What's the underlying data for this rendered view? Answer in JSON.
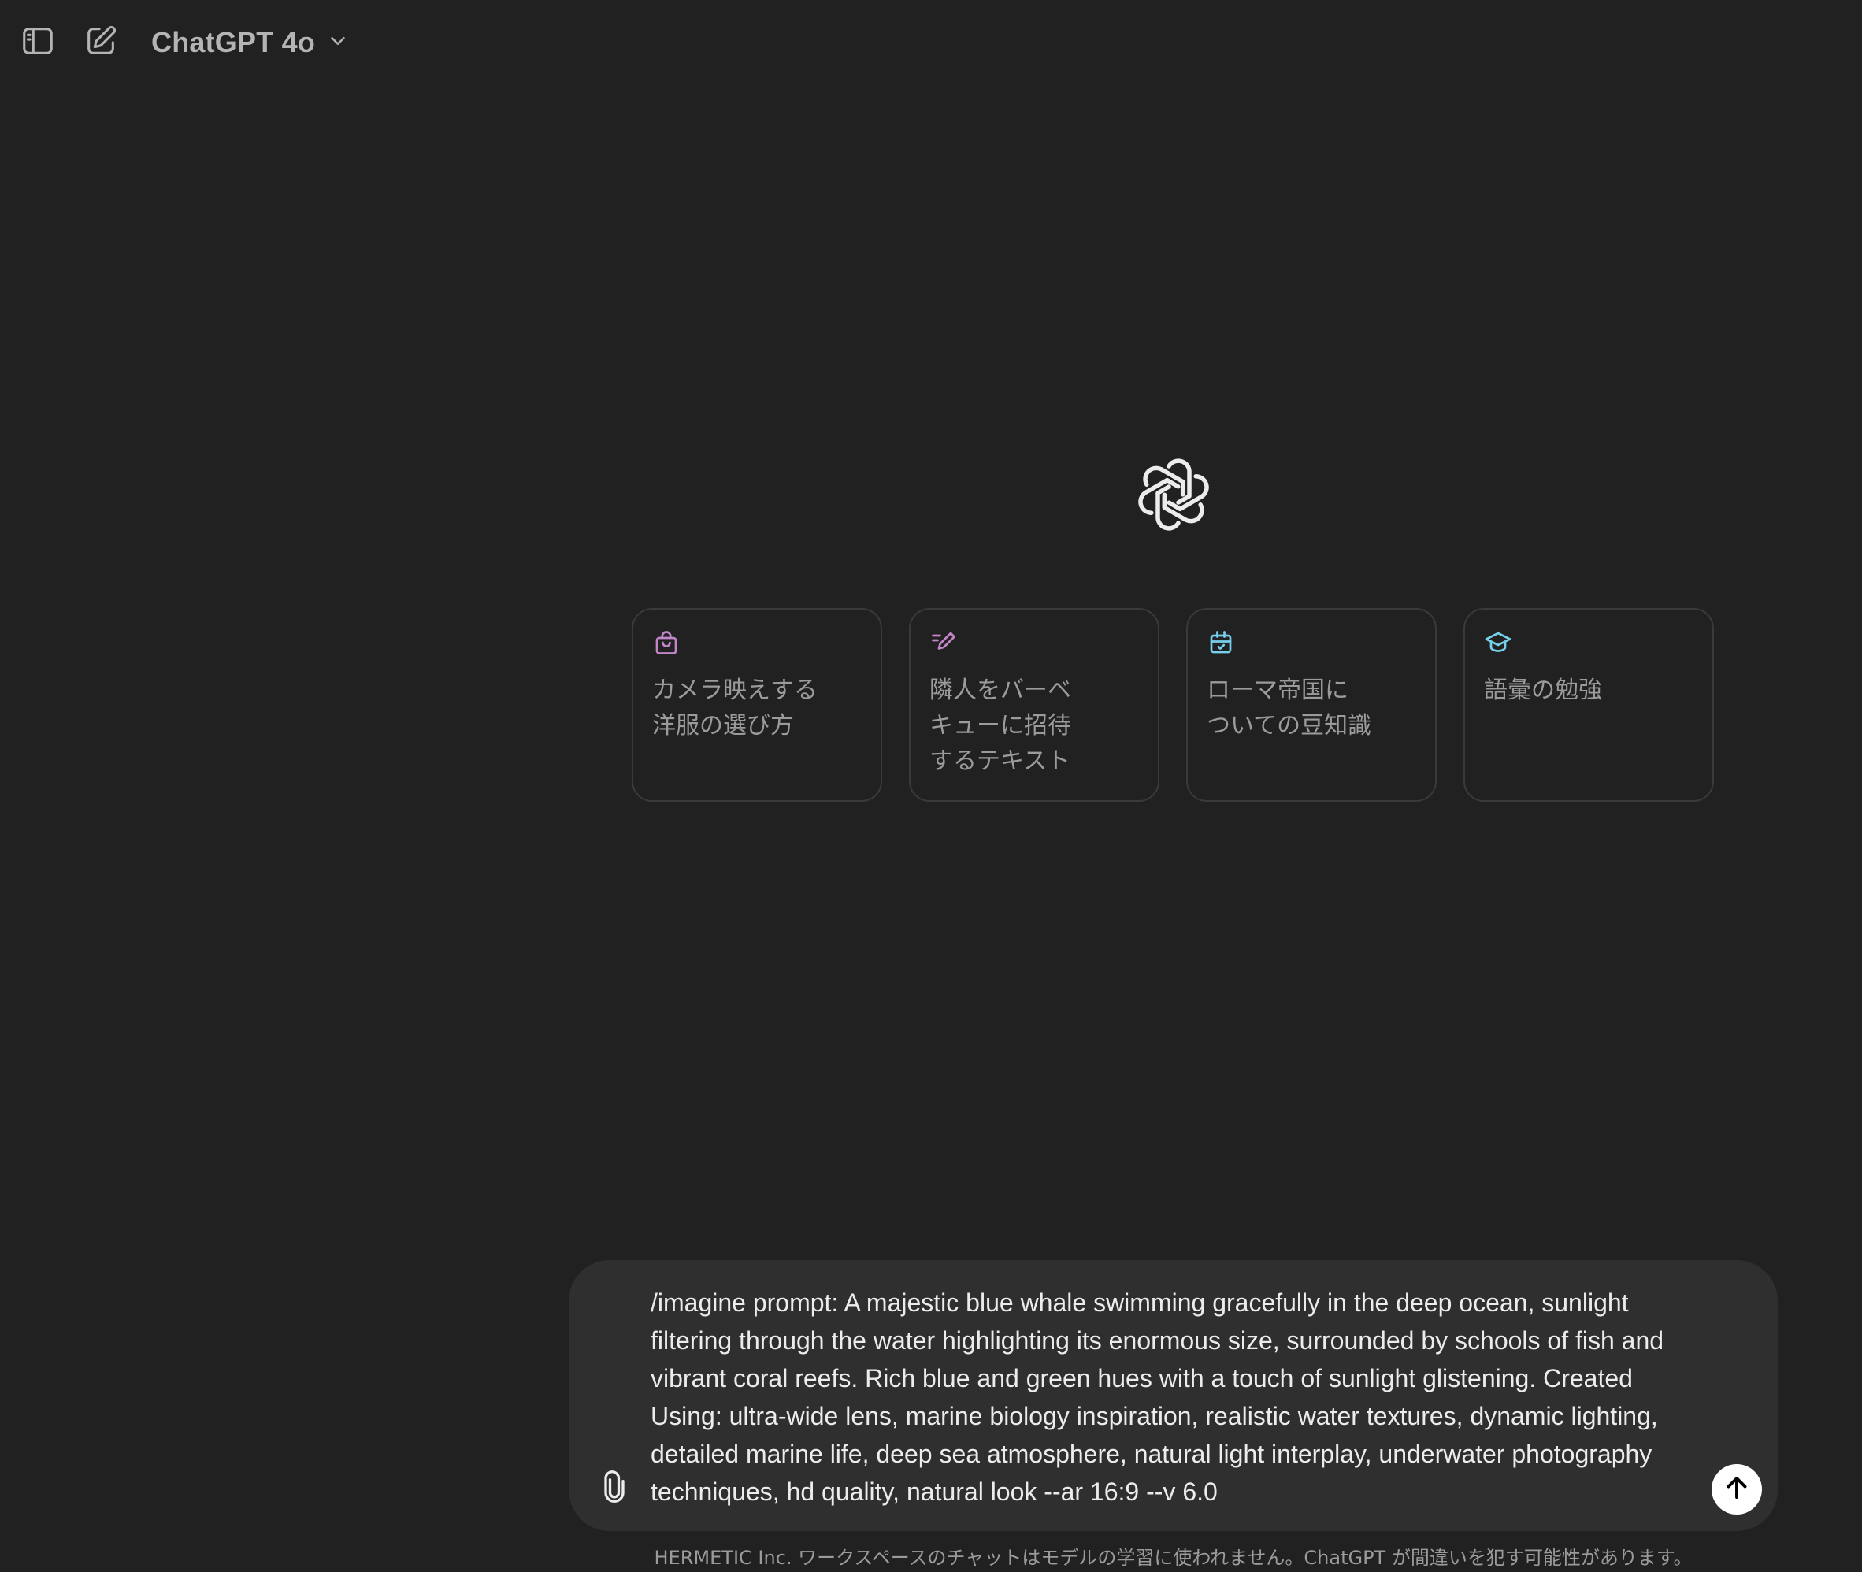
{
  "header": {
    "sidebar_toggle_icon": "sidebar-icon",
    "new_chat_icon": "compose-icon",
    "model_name": "ChatGPT 4o",
    "model_dropdown_icon": "chevron-down-icon"
  },
  "logo": {
    "icon": "openai-logo"
  },
  "suggestions": [
    {
      "icon": "shopping-bag-icon",
      "icon_color": "#c285c8",
      "text": "カメラ映えする\n洋服の選び方"
    },
    {
      "icon": "pen-lines-icon",
      "icon_color": "#c285c8",
      "text": "隣人をバーベ\nキューに招待\nするテキスト"
    },
    {
      "icon": "calendar-icon",
      "icon_color": "#76d0eb",
      "text": "ローマ帝国に\nついての豆知識"
    },
    {
      "icon": "graduation-cap-icon",
      "icon_color": "#76d0eb",
      "text": "語彙の勉強"
    }
  ],
  "composer": {
    "attach_icon": "paperclip-icon",
    "value": "/imagine prompt: A majestic blue whale swimming gracefully in the deep ocean, sunlight filtering through the water highlighting its enormous size, surrounded by schools of fish and vibrant coral reefs. Rich blue and green hues with a touch of sunlight glistening. Created Using: ultra-wide lens, marine biology inspiration, realistic water textures, dynamic lighting, detailed marine life, deep sea atmosphere, natural light interplay, underwater photography techniques, hd quality, natural look --ar 16:9 --v 6.0",
    "send_icon": "arrow-up-icon"
  },
  "disclaimer": "HERMETIC Inc. ワークスペースのチャットはモデルの学習に使われません。ChatGPT が間違いを犯す可能性があります。",
  "colors": {
    "background": "#212121",
    "composer_bg": "#2f2f2f",
    "card_border": "#3a3a3a",
    "text_primary": "#ececec",
    "text_secondary": "#9b9b9b",
    "accent_purple": "#c285c8",
    "accent_cyan": "#76d0eb"
  }
}
